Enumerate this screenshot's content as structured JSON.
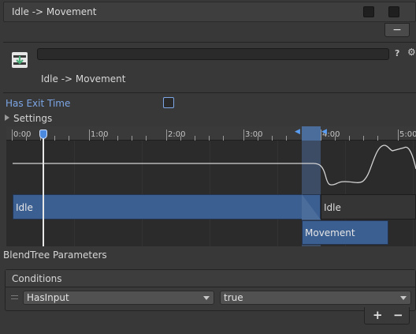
{
  "header": {
    "transition_label": "Idle -> Movement",
    "minus_label": "−"
  },
  "inspector": {
    "title": "Idle -> Movement",
    "help_icon": "?",
    "gear_icon": "⚙"
  },
  "settings": {
    "has_exit_time_label": "Has Exit Time",
    "has_exit_time": false,
    "settings_label": "Settings"
  },
  "timeline": {
    "ticks": [
      "0:00",
      "1:00",
      "2:00",
      "3:00",
      "4:00",
      "5:00"
    ],
    "bars": {
      "source_state": "Idle",
      "dest_state_top": "Idle",
      "dest_state": "Movement"
    }
  },
  "blend_tree_label": "BlendTree Parameters",
  "conditions": {
    "header": "Conditions",
    "items": [
      {
        "parameter": "HasInput",
        "value": "true"
      }
    ],
    "add_label": "+",
    "remove_label": "−"
  },
  "colors": {
    "accent": "#7ca6e6",
    "state_bar": "#3c5f91",
    "background": "#383838"
  }
}
